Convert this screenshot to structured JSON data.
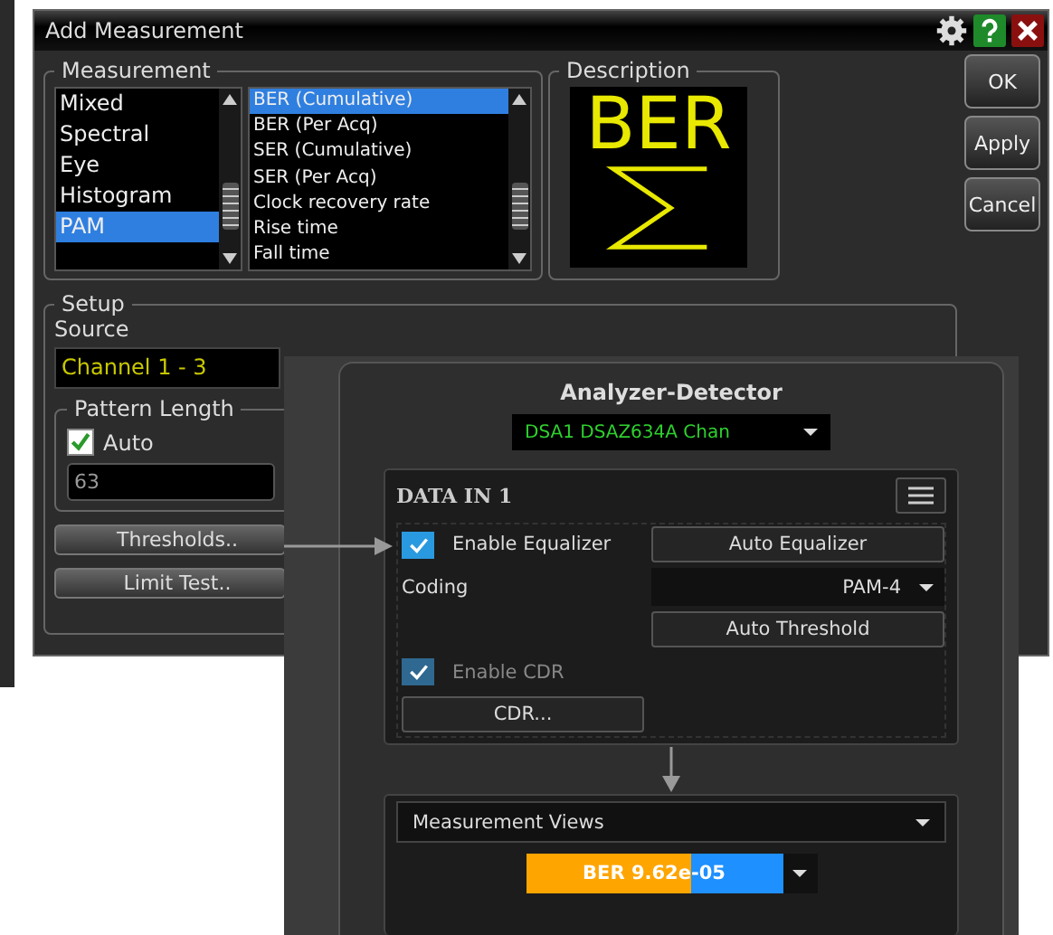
{
  "dialog": {
    "title": "Add Measurement"
  },
  "measurement": {
    "label": "Measurement",
    "categories": [
      {
        "label": "Mixed",
        "selected": false
      },
      {
        "label": "Spectral",
        "selected": false
      },
      {
        "label": "Eye",
        "selected": false
      },
      {
        "label": "Histogram",
        "selected": false
      },
      {
        "label": "PAM",
        "selected": true
      }
    ],
    "items": [
      {
        "label": "BER (Cumulative)",
        "selected": true
      },
      {
        "label": "BER (Per Acq)",
        "selected": false
      },
      {
        "label": "SER (Cumulative)",
        "selected": false
      },
      {
        "label": "SER (Per Acq)",
        "selected": false
      },
      {
        "label": "Clock recovery rate",
        "selected": false
      },
      {
        "label": "Rise time",
        "selected": false
      },
      {
        "label": "Fall time",
        "selected": false
      }
    ]
  },
  "description": {
    "label": "Description",
    "text": "BER"
  },
  "buttons": [
    "OK",
    "Apply",
    "Cancel"
  ],
  "setup": {
    "label": "Setup",
    "source_label": "Source",
    "source_value": "Channel 1 - 3",
    "pattern_length": {
      "label": "Pattern Length",
      "auto": {
        "label": "Auto",
        "checked": true
      },
      "value": "63"
    },
    "buttons": [
      "Thresholds..",
      "Limit Test.."
    ]
  },
  "analyzer": {
    "title": "Analyzer-Detector",
    "device": "DSA1 DSAZ634A Chan",
    "data_in": {
      "title": "DATA IN 1",
      "enable_equalizer": {
        "label": "Enable Equalizer",
        "checked": true,
        "disabled": false
      },
      "auto_equalizer": "Auto Equalizer",
      "coding_label": "Coding",
      "coding_value": "PAM-4",
      "auto_threshold": "Auto Threshold",
      "enable_cdr": {
        "label": "Enable CDR",
        "checked": true,
        "disabled": true
      },
      "cdr_button": "CDR..."
    },
    "views": {
      "dropdown": "Measurement Views",
      "result": "BER 9.62e-05"
    }
  }
}
